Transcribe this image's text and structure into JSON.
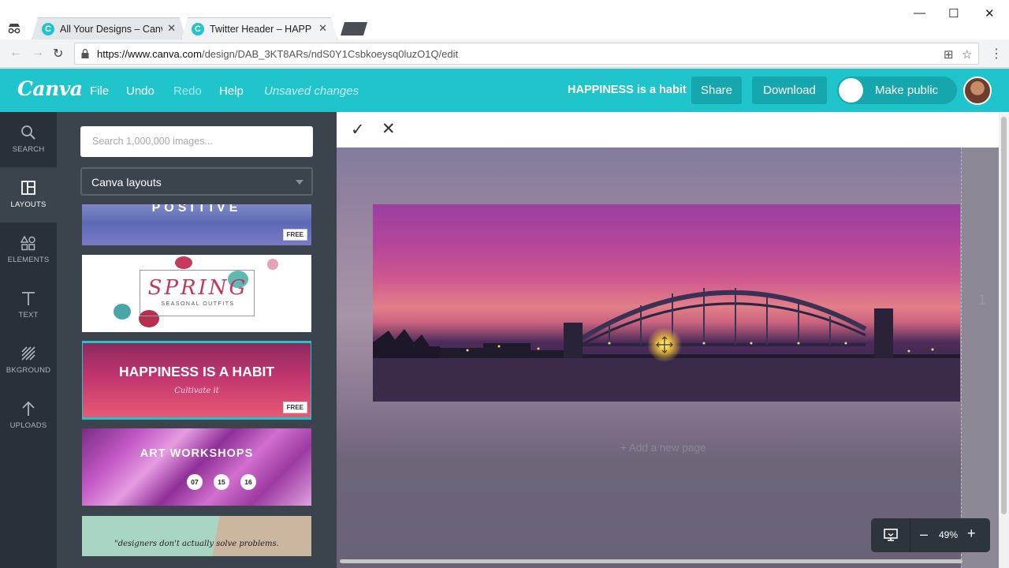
{
  "browser": {
    "tabs": [
      {
        "title": "All Your Designs – Canva",
        "favicon": "C"
      },
      {
        "title": "Twitter Header – HAPPINESS is a habit",
        "favicon": "C"
      }
    ],
    "url_host": "https://www.canva.com",
    "url_path": "/design/DAB_3KT8ARs/ndS0Y1Csbkoeysq0luzO1Q/edit",
    "close_glyph": "✕",
    "min_glyph": "—",
    "max_glyph": "☐",
    "winclose_glyph": "✕",
    "back_glyph": "←",
    "forward_glyph": "→",
    "reload_glyph": "↻",
    "translate_glyph": "⊞",
    "star_glyph": "☆",
    "menu_glyph": "⋮"
  },
  "topbar": {
    "logo": "Canva",
    "menu": [
      "File",
      "Undo",
      "Redo",
      "Help"
    ],
    "status": "Unsaved changes",
    "doc_title": "HAPPINESS is a habit",
    "share": "Share",
    "download": "Download",
    "make_public": "Make public",
    "accent": "#20c4cb"
  },
  "rail": [
    {
      "label": "SEARCH",
      "icon": "search-icon"
    },
    {
      "label": "LAYOUTS",
      "icon": "layouts-icon"
    },
    {
      "label": "ELEMENTS",
      "icon": "elements-icon"
    },
    {
      "label": "TEXT",
      "icon": "text-icon"
    },
    {
      "label": "BKGROUND",
      "icon": "background-icon"
    },
    {
      "label": "UPLOADS",
      "icon": "upload-icon"
    }
  ],
  "panel": {
    "search_placeholder": "Search 1,000,000 images...",
    "select_value": "Canva layouts",
    "free_badge": "FREE",
    "thumbs": {
      "positive": "POSITIVE",
      "spring_title": "SPRING",
      "spring_sub": "SEASONAL OUTFITS",
      "happy_title": "HAPPINESS IS A HABIT",
      "happy_sub": "Cultivate it",
      "art_title": "ART WORKSHOPS",
      "art_dates": [
        "07",
        "15",
        "16"
      ],
      "quote": "\"designers don't actually solve problems."
    }
  },
  "stage": {
    "confirm_glyph": "✓",
    "cancel_glyph": "✕",
    "page_number": "1",
    "add_page": "+ Add a new page",
    "zoom": "49%",
    "zoom_minus": "–",
    "zoom_plus": "+"
  }
}
